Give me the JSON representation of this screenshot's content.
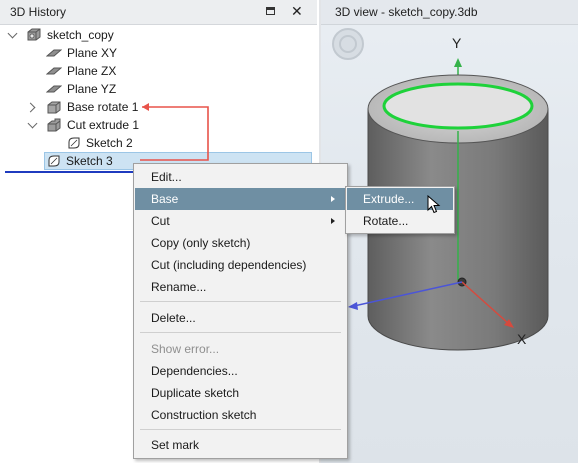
{
  "history": {
    "title": "3D History",
    "close_glyph": "✕",
    "items": [
      {
        "label": "sketch_copy",
        "icon": "part-icon"
      },
      {
        "label": "Plane XY",
        "icon": "plane-icon"
      },
      {
        "label": "Plane ZX",
        "icon": "plane-icon"
      },
      {
        "label": "Plane YZ",
        "icon": "plane-icon"
      },
      {
        "label": "Base rotate 1",
        "icon": "base-rotate-icon"
      },
      {
        "label": "Cut extrude 1",
        "icon": "cut-extrude-icon"
      },
      {
        "label": "Sketch 2",
        "icon": "sketch-icon"
      },
      {
        "label": "Sketch 3",
        "icon": "sketch-icon"
      }
    ]
  },
  "view": {
    "title": "3D view - sketch_copy.3db",
    "axis_y": "Y",
    "axis_x": "X"
  },
  "context_menu": {
    "items": [
      {
        "label": "Edit..."
      },
      {
        "label": "Base",
        "submenu": true,
        "highlighted": true
      },
      {
        "label": "Cut",
        "submenu": true
      },
      {
        "label": "Copy (only sketch)"
      },
      {
        "label": "Cut (including dependencies)"
      },
      {
        "label": "Rename..."
      },
      {
        "label": "Delete..."
      },
      {
        "label": "Show error...",
        "disabled": true
      },
      {
        "label": "Dependencies..."
      },
      {
        "label": "Duplicate sketch"
      },
      {
        "label": "Construction sketch"
      },
      {
        "label": "Set mark"
      }
    ]
  },
  "submenu": {
    "items": [
      {
        "label": "Extrude...",
        "highlighted": true
      },
      {
        "label": "Rotate..."
      }
    ]
  },
  "colors": {
    "selection": "#cde3f3",
    "menu_highlight": "#6f8fa3",
    "dependency_arrow": "#e8534a",
    "axis_y": "#35b24a",
    "axis_x": "#d64a3e",
    "axis_z": "#4b55d8",
    "sketch_circle": "#1ed23a"
  }
}
